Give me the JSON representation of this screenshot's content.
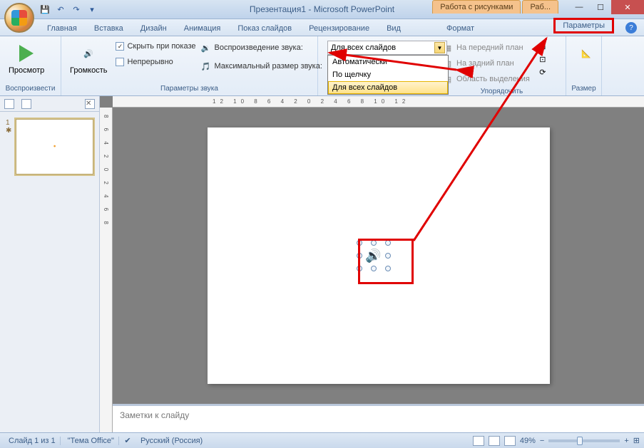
{
  "title": "Презентация1 - Microsoft PowerPoint",
  "context_tabs": [
    "Работа с рисунками",
    "Раб..."
  ],
  "tabs": {
    "home": "Главная",
    "insert": "Вставка",
    "design": "Дизайн",
    "animation": "Анимация",
    "slideshow": "Показ слайдов",
    "review": "Рецензирование",
    "view": "Вид",
    "format": "Формат",
    "parameters": "Параметры"
  },
  "ribbon": {
    "play_group": "Воспроизвести",
    "preview": "Просмотр",
    "volume": "Громкость",
    "hide_on_show": "Скрыть при показе",
    "loop": "Непрерывно",
    "play_sound": "Воспроизведение звука:",
    "max_size": "Максимальный размер звука:",
    "sound_params_group": "Параметры звука",
    "dropdown_value": "Для всех слайдов",
    "dd_options": {
      "auto": "Автоматически",
      "click": "По щелчку",
      "all": "Для всех слайдов"
    },
    "bring_front": "На передний план",
    "send_back": "На задний план",
    "selection_pane": "Область выделения",
    "arrange_group": "Упорядочить",
    "size": "Размер"
  },
  "notes_placeholder": "Заметки к слайду",
  "status": {
    "slide": "Слайд 1 из 1",
    "theme": "\"Тема Office\"",
    "lang": "Русский (Россия)",
    "zoom": "49%"
  },
  "ruler": "12 10 8 6 4 2 0 2 4 6 8 10 12",
  "ruler_v": "8 6 4 2 0 2 4 6 8"
}
